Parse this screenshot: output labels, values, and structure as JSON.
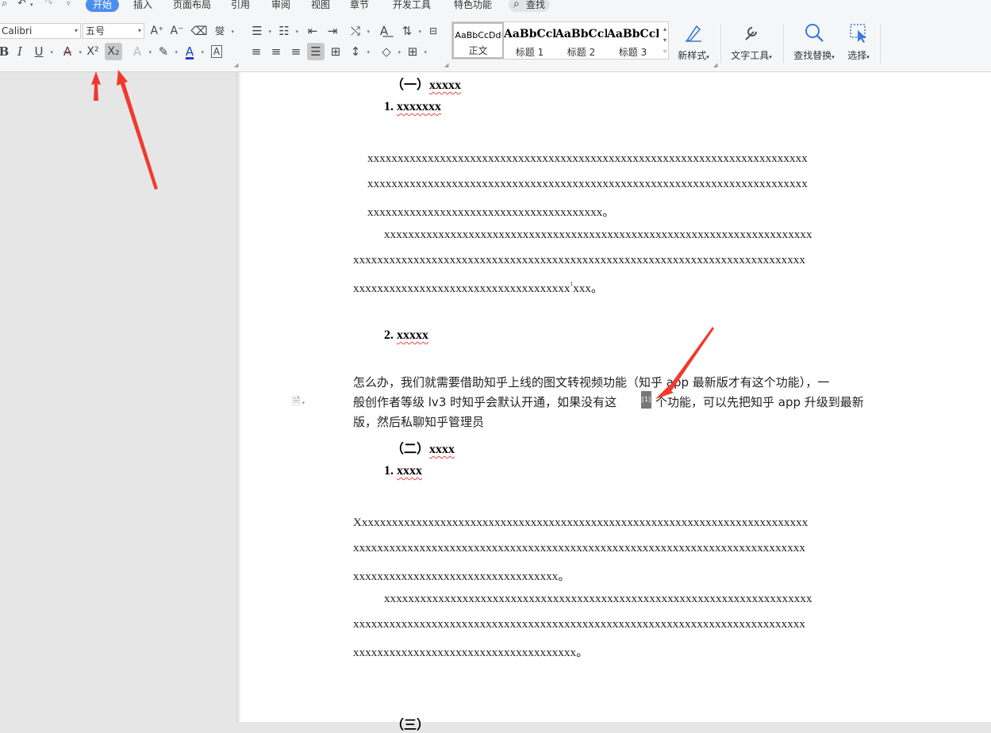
{
  "menu": {
    "tabs": [
      "开始",
      "插入",
      "页面布局",
      "引用",
      "审阅",
      "视图",
      "章节",
      "开发工具",
      "特色功能"
    ],
    "active_tab": "开始",
    "search_label": "查找"
  },
  "font": {
    "name": "Calibri",
    "size": "五号"
  },
  "styles": [
    {
      "preview": "AaBbCcDd",
      "name": "正文"
    },
    {
      "preview": "AaBbCcl",
      "name": "标题 1"
    },
    {
      "preview": "AaBbCcI",
      "name": "标题 2"
    },
    {
      "preview": "AaBbCcl",
      "name": "标题 3"
    }
  ],
  "ribbon_buttons": {
    "new_style": "新样式",
    "text_tools": "文字工具",
    "find_replace": "查找替换",
    "select": "选择"
  },
  "document": {
    "section1": "（一）",
    "section1_title": "xxxxx",
    "item1_num": "1.",
    "item1_title": "xxxxxxx",
    "p1_l1": "xxxxxxxxxxxxxxxxxxxxxxxxxxxxxxxxxxxxxxxxxxxxxxxxxxxxxxxxxxxxxxxxxxxxxxxxx",
    "p1_l2": "xxxxxxxxxxxxxxxxxxxxxxxxxxxxxxxxxxxxxxxxxxxxxxxxxxxxxxxxxxxxxxxxxxxxxxxxx",
    "p1_l3": "xxxxxxxxxxxxxxxxxxxxxxxxxxxxxxxxxxxxxxx。",
    "p2_l1": "xxxxxxxxxxxxxxxxxxxxxxxxxxxxxxxxxxxxxxxxxxxxxxxxxxxxxxxxxxxxxxxxxxxxxxx",
    "p2_l2": "xxxxxxxxxxxxxxxxxxxxxxxxxxxxxxxxxxxxxxxxxxxxxxxxxxxxxxxxxxxxxxxxxxxxxxxxxxx",
    "p2_l3a": "xxxxxxxxxxxxxxxxxxxxxxxxxxxxxxxxxxxx",
    "footnote_sup": "1",
    "p2_l3b": "xxx。",
    "item2_num": "2.",
    "item2_title": "xxxxx",
    "cn_l1": "怎么办，我们就需要借助知乎上线的图文转视频功能（知乎 app 最新版才有这个功能），一",
    "cn_l2a": "般创作者等级 lv3 时知乎会默认开通，如果没有这",
    "footnote_ref": "[1]",
    "cn_l2b": "个功能，可以先把知乎 app 升级到最新",
    "cn_l3": "版，然后私聊知乎管理员",
    "section2": "（二）",
    "section2_title": "xxxx",
    "item3_num": "1.",
    "item3_title": "xxxx",
    "p3_l1": "Xxxxxxxxxxxxxxxxxxxxxxxxxxxxxxxxxxxxxxxxxxxxxxxxxxxxxxxxxxxxxxxxxxxxxxxxxxx",
    "p3_l2": "xxxxxxxxxxxxxxxxxxxxxxxxxxxxxxxxxxxxxxxxxxxxxxxxxxxxxxxxxxxxxxxxxxxxxxxxxxx",
    "p3_l3": "xxxxxxxxxxxxxxxxxxxxxxxxxxxxxxxxxx。",
    "p4_l1": "xxxxxxxxxxxxxxxxxxxxxxxxxxxxxxxxxxxxxxxxxxxxxxxxxxxxxxxxxxxxxxxxxxxxxxx",
    "p4_l2": "xxxxxxxxxxxxxxxxxxxxxxxxxxxxxxxxxxxxxxxxxxxxxxxxxxxxxxxxxxxxxxxxxxxxxxxxxxx",
    "p4_l3": "xxxxxxxxxxxxxxxxxxxxxxxxxxxxxxxxxxxxx。",
    "section3_partial": "（三）"
  },
  "colors": {
    "accent": "#4a8ef0",
    "annotation_arrow": "#f03a2e",
    "spellcheck": "#e44444"
  }
}
